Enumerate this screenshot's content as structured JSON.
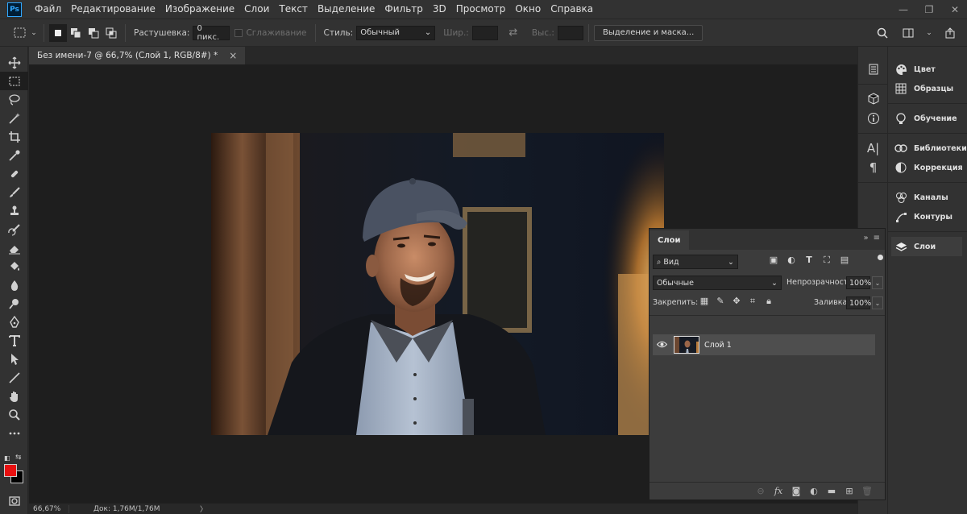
{
  "app": {
    "logo_text": "Ps"
  },
  "menu": [
    "Файл",
    "Редактирование",
    "Изображение",
    "Слои",
    "Текст",
    "Выделение",
    "Фильтр",
    "3D",
    "Просмотр",
    "Окно",
    "Справка"
  ],
  "window_controls": {
    "minimize": "—",
    "maximize": "❐",
    "close": "✕"
  },
  "options": {
    "feather_label": "Растушевка:",
    "feather_value": "0 пикс.",
    "antialias_label": "Сглаживание",
    "style_label": "Стиль:",
    "style_value": "Обычный",
    "width_label": "Шир.:",
    "height_label": "Выс.:",
    "select_mask_button": "Выделение и маска..."
  },
  "document": {
    "tab_title": "Без имени-7 @ 66,7% (Слой 1, RGB/8#) *",
    "close": "×"
  },
  "status": {
    "zoom": "66,67%",
    "doc_info": "Док: 1,76M/1,76M",
    "arrow": "〉"
  },
  "colors": {
    "foreground": "#e81010",
    "background": "#000000",
    "accent": "#31a8ff"
  },
  "dock": {
    "panels": [
      "Цвет",
      "Образцы",
      "Обучение",
      "Библиотеки",
      "Коррекция",
      "Каналы",
      "Контуры",
      "Слои"
    ],
    "active": "Слои"
  },
  "layers_panel": {
    "tab": "Слои",
    "filter_value": "Вид",
    "blend_mode": "Обычные",
    "opacity_label": "Непрозрачность:",
    "opacity_value": "100%",
    "lock_label": "Закрепить:",
    "fill_label": "Заливка:",
    "fill_value": "100%",
    "layers": [
      {
        "name": "Слой 1",
        "visible": true
      }
    ]
  }
}
